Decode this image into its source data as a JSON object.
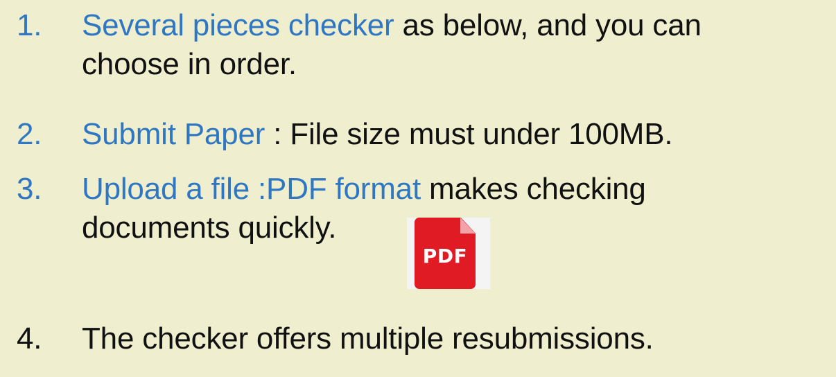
{
  "items": [
    {
      "number": "1.",
      "highlight": "Several pieces checker",
      "rest_line1": " as below, and you can",
      "line2": "choose in order."
    },
    {
      "number": "2.",
      "highlight": "Submit Paper",
      "rest_line1": " : File size must under 100MB."
    },
    {
      "number": "3.",
      "highlight": "Upload a file :PDF format",
      "rest_line1": " makes checking",
      "line2": "documents quickly."
    },
    {
      "number": "4.",
      "text": "The checker offers multiple resubmissions."
    }
  ],
  "pdf_icon": {
    "icon": "pdf-file-icon",
    "label": "PDF"
  },
  "colors": {
    "background": "#efefcf",
    "accent": "#2f77c2",
    "text": "#111111",
    "pdf_red": "#e01b24"
  }
}
